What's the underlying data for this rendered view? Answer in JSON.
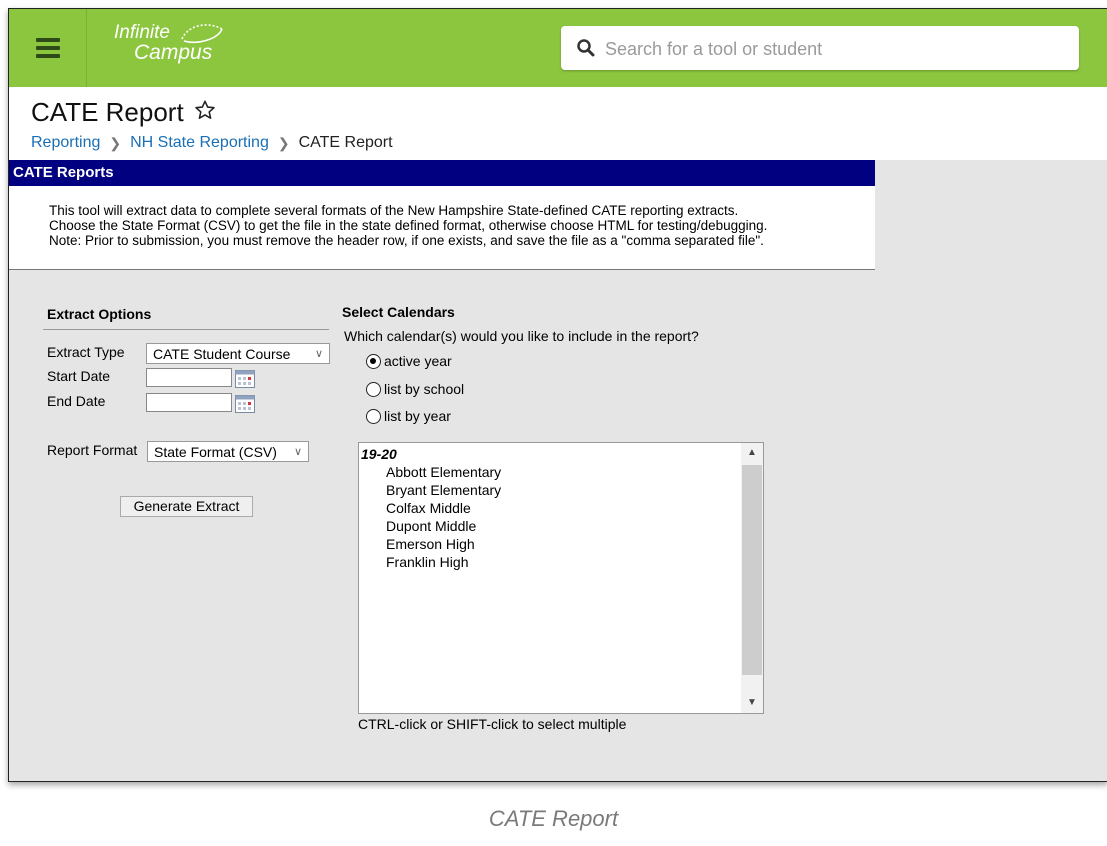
{
  "topbar": {
    "logo_line1": "Infinite",
    "logo_line2": "Campus",
    "search_placeholder": "Search for a tool or student"
  },
  "page": {
    "title": "CATE Report",
    "breadcrumbs": [
      "Reporting",
      "NH State Reporting",
      "CATE Report"
    ]
  },
  "section": {
    "header": "CATE Reports",
    "description": [
      "This tool will extract data to complete several formats of the New Hampshire State-defined CATE reporting extracts.",
      "Choose the State Format (CSV) to get the file in the state defined format, otherwise choose HTML for testing/debugging.",
      "Note: Prior to submission, you must remove the header row, if one exists, and save the file as a \"comma separated file\"."
    ]
  },
  "extract_options": {
    "heading": "Extract Options",
    "extract_type_label": "Extract Type",
    "extract_type_value": "CATE Student Course",
    "start_date_label": "Start Date",
    "start_date_value": "",
    "end_date_label": "End Date",
    "end_date_value": "",
    "report_format_label": "Report Format",
    "report_format_value": "State Format (CSV)",
    "generate_button": "Generate Extract"
  },
  "calendars": {
    "heading": "Select Calendars",
    "question": "Which calendar(s) would you like to include in the report?",
    "radios": [
      {
        "label": "active year",
        "checked": true
      },
      {
        "label": "list by school",
        "checked": false
      },
      {
        "label": "list by year",
        "checked": false
      }
    ],
    "group": "19-20",
    "schools": [
      "Abbott Elementary",
      "Bryant Elementary",
      "Colfax Middle",
      "Dupont Middle",
      "Emerson High",
      "Franklin High"
    ],
    "hint": "CTRL-click or SHIFT-click to select multiple"
  },
  "caption": "CATE Report",
  "colors": {
    "topbar": "#8cc63f",
    "section_bar": "#000080",
    "link": "#1a6fb5",
    "panel_bg": "#e5e5e5"
  }
}
